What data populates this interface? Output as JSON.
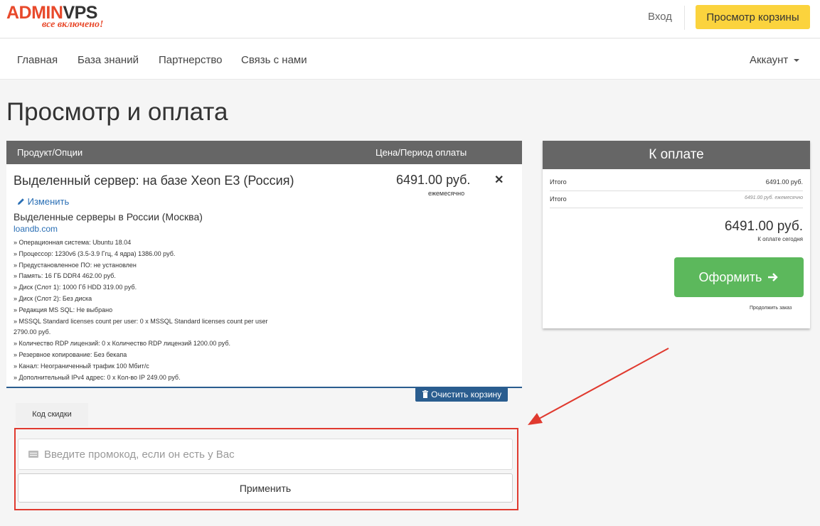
{
  "header": {
    "logo_main_1": "ADMIN",
    "logo_main_2": "V",
    "logo_main_3": "PS",
    "logo_tagline": "все включено!",
    "login_label": "Вход",
    "cart_button_label": "Просмотр корзины"
  },
  "nav": {
    "items": [
      {
        "label": "Главная"
      },
      {
        "label": "База знаний"
      },
      {
        "label": "Партнерство"
      },
      {
        "label": "Связь с нами"
      }
    ],
    "account_label": "Аккаунт"
  },
  "page": {
    "title": "Просмотр и оплата"
  },
  "cart": {
    "col_product": "Продукт/Опции",
    "col_price": "Цена/Период оплаты",
    "product_name": "Выделенный сервер: на базе Xeon E3 (Россия)",
    "edit_label": "Изменить",
    "group_name": "Выделенные серверы в России (Москва)",
    "domain": "loandb.com",
    "price": "6491.00 руб.",
    "period": "ежемесячно",
    "options": [
      "» Операционная система: Ubuntu 18.04",
      "» Процессор: 1230v6 (3.5-3.9 Ггц, 4 ядра) 1386.00 руб.",
      "» Предустановленное ПО: не установлен",
      "» Память: 16 ГБ DDR4 462.00 руб.",
      "» Диск (Слот 1): 1000 Гб HDD 319.00 руб.",
      "» Диск (Слот 2): Без диска",
      "» Редакция MS SQL: Не выбрано",
      "» MSSQL Standard licenses count per user: 0 x MSSQL Standard licenses count per user",
      "2790.00 руб.",
      "» Количество RDP лицензий: 0 x Количество RDP лицензий 1200.00 руб.",
      "» Резервное копирование: Без бекапа",
      "» Канал: Неограниченный трафик 100 Мбит/с",
      "» Дополнительный IPv4 адрес: 0 x Кол-во IP 249.00 руб."
    ],
    "empty_cart_label": "Очистить корзину"
  },
  "promo": {
    "tab_label": "Код скидки",
    "placeholder": "Введите промокод, если он есть у Вас",
    "apply_label": "Применить"
  },
  "summary": {
    "title": "К оплате",
    "row1_label": "Итого",
    "row1_value": "6491.00 руб.",
    "row2_label": "Итого",
    "row2_value": "6491.00 руб. ежемесячно",
    "total": "6491.00 руб.",
    "total_label": "К оплате сегодня",
    "checkout_label": "Оформить",
    "continue_label": "Продолжить заказ"
  },
  "colors": {
    "brand": "#e8492b",
    "cart_button": "#fbd33d",
    "checkout": "#5cb85c",
    "highlight": "#e03a2f"
  }
}
